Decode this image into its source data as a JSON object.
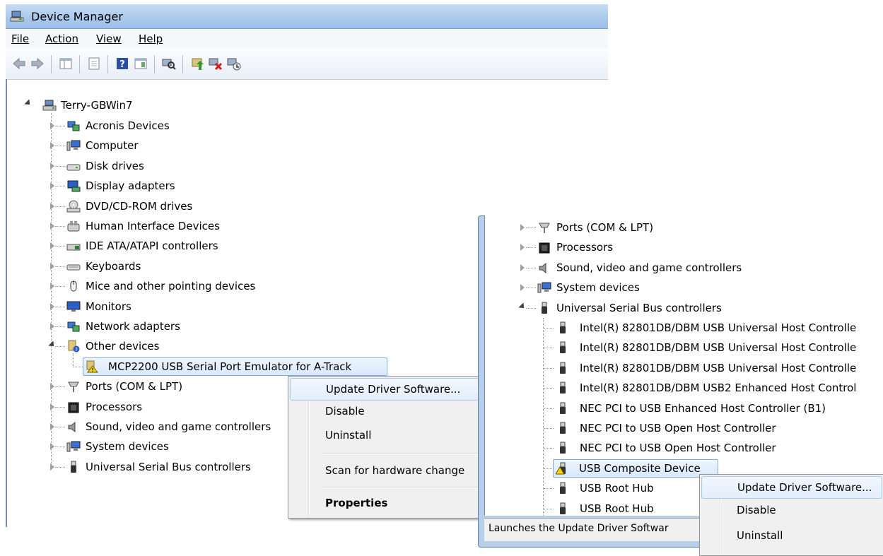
{
  "window": {
    "title": "Device Manager",
    "menu": [
      "File",
      "Action",
      "View",
      "Help"
    ],
    "toolbar_icons": [
      "back-icon",
      "forward-icon",
      "show-hide-tree-icon",
      "properties-icon",
      "help-icon",
      "action-pane-icon",
      "scan-hardware-icon",
      "update-driver-icon",
      "uninstall-icon",
      "disable-icon"
    ]
  },
  "tree": {
    "root": "Terry-GBWin7",
    "categories": [
      {
        "label": "Acronis Devices",
        "icon": "network-device-icon",
        "expanded": false
      },
      {
        "label": "Computer",
        "icon": "computer-icon",
        "expanded": false
      },
      {
        "label": "Disk drives",
        "icon": "disk-drive-icon",
        "expanded": false
      },
      {
        "label": "Display adapters",
        "icon": "display-adapter-icon",
        "expanded": false
      },
      {
        "label": "DVD/CD-ROM drives",
        "icon": "dvd-drive-icon",
        "expanded": false
      },
      {
        "label": "Human Interface Devices",
        "icon": "hid-icon",
        "expanded": false
      },
      {
        "label": "IDE ATA/ATAPI controllers",
        "icon": "ide-controller-icon",
        "expanded": false
      },
      {
        "label": "Keyboards",
        "icon": "keyboard-icon",
        "expanded": false
      },
      {
        "label": "Mice and other pointing devices",
        "icon": "mouse-icon",
        "expanded": false
      },
      {
        "label": "Monitors",
        "icon": "monitor-icon",
        "expanded": false
      },
      {
        "label": "Network adapters",
        "icon": "network-adapter-icon",
        "expanded": false
      },
      {
        "label": "Other devices",
        "icon": "unknown-device-icon",
        "expanded": true
      },
      {
        "label": "Ports (COM & LPT)",
        "icon": "port-icon",
        "expanded": false
      },
      {
        "label": "Processors",
        "icon": "processor-icon",
        "expanded": false
      },
      {
        "label": "Sound, video and game controllers",
        "icon": "speaker-icon",
        "expanded": false
      },
      {
        "label": "System devices",
        "icon": "system-device-icon",
        "expanded": false
      },
      {
        "label": "Universal Serial Bus controllers",
        "icon": "usb-icon",
        "expanded": false
      }
    ],
    "other_devices_child": "MCP2200 USB Serial Port Emulator for A-Track"
  },
  "context_menu_1": {
    "items": [
      "Update Driver Software...",
      "Disable",
      "Uninstall",
      "Scan for hardware change",
      "Properties"
    ]
  },
  "window2": {
    "categories": [
      {
        "label": "Ports (COM & LPT)",
        "icon": "port-icon"
      },
      {
        "label": "Processors",
        "icon": "processor-icon"
      },
      {
        "label": "Sound, video and game controllers",
        "icon": "speaker-icon"
      },
      {
        "label": "System devices",
        "icon": "system-device-icon"
      },
      {
        "label": "Universal Serial Bus controllers",
        "icon": "usb-icon"
      }
    ],
    "usb_children": [
      "Intel(R) 82801DB/DBM USB Universal Host Controlle",
      "Intel(R) 82801DB/DBM USB Universal Host Controlle",
      "Intel(R) 82801DB/DBM USB Universal Host Controlle",
      "Intel(R) 82801DB/DBM USB2 Enhanced Host Control",
      "NEC PCI to USB Enhanced Host Controller (B1)",
      "NEC PCI to USB Open Host Controller",
      "NEC PCI to USB Open Host Controller",
      "USB Composite Device",
      "USB Root Hub",
      "USB Root Hub"
    ],
    "status_text": "Launches the Update Driver Softwar"
  },
  "context_menu_2": {
    "items": [
      "Update Driver Software...",
      "Disable",
      "Uninstall"
    ]
  }
}
